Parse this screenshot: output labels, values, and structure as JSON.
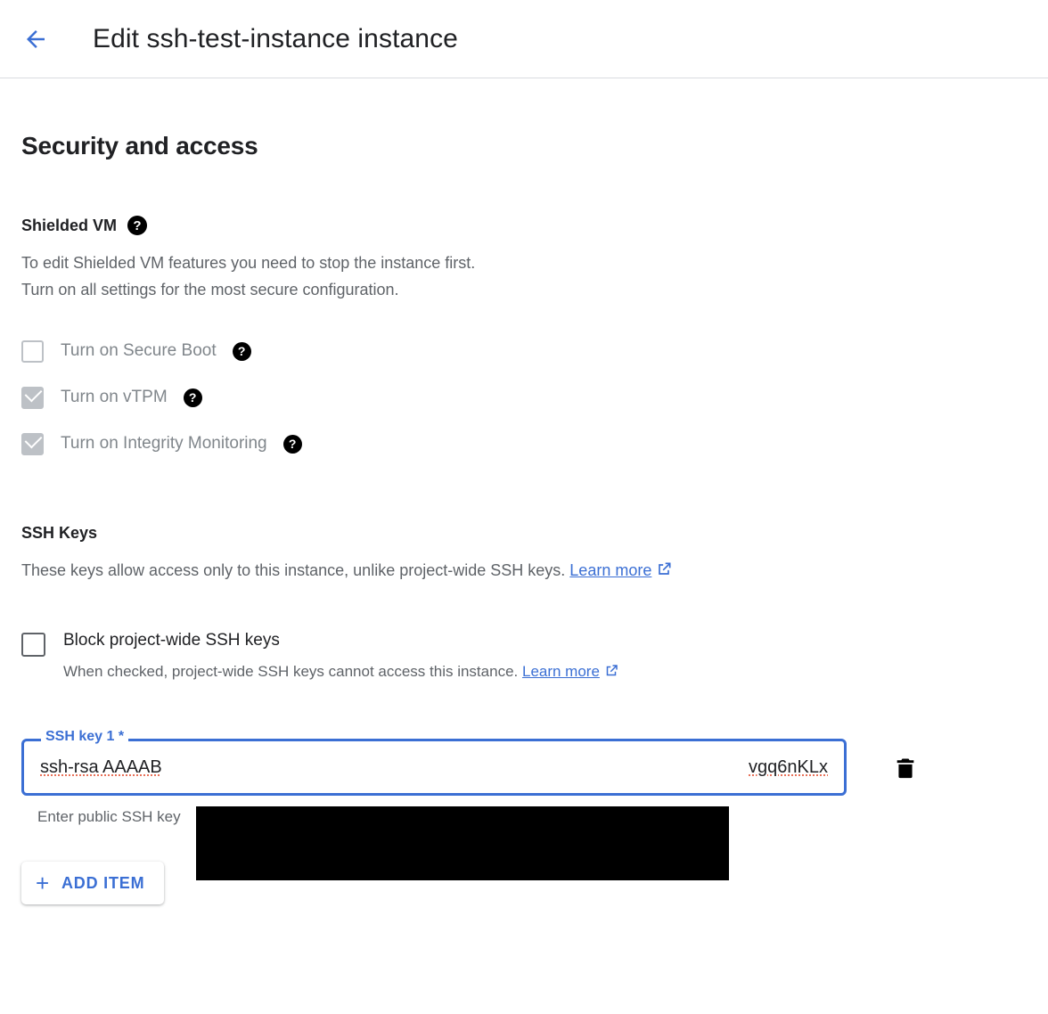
{
  "header": {
    "back_icon": "arrow-left-icon",
    "title": "Edit ssh-test-instance instance"
  },
  "main": {
    "section_title": "Security and access",
    "shielded_vm": {
      "heading": "Shielded VM",
      "help_icon": "help-icon",
      "description_line1": "To edit Shielded VM features you need to stop the instance first.",
      "description_line2": "Turn on all settings for the most secure configuration.",
      "options": [
        {
          "label": "Turn on Secure Boot",
          "checked": false,
          "disabled": true
        },
        {
          "label": "Turn on vTPM",
          "checked": true,
          "disabled": true
        },
        {
          "label": "Turn on Integrity Monitoring",
          "checked": true,
          "disabled": true
        }
      ]
    },
    "ssh_keys": {
      "heading": "SSH Keys",
      "description": "These keys allow access only to this instance, unlike project-wide SSH keys.",
      "learn_more": "Learn more",
      "external_link_icon": "external-link-icon",
      "block_project_wide": {
        "label": "Block project-wide SSH keys",
        "description": "When checked, project-wide SSH keys cannot access this instance.",
        "learn_more": "Learn more",
        "checked": false
      },
      "key_field": {
        "label": "SSH key 1 *",
        "value_start": "ssh-rsa AAAAB",
        "value_end": "vgq6nKLx",
        "hint": "Enter public SSH key",
        "delete_icon": "trash-icon"
      },
      "add_item": {
        "plus": "+",
        "label": "ADD ITEM"
      }
    }
  },
  "colors": {
    "accent_blue": "#3b6fd4",
    "text_primary": "#202124",
    "text_secondary": "#5f6368",
    "disabled_gray": "#bdc1c6",
    "divider": "#dadce0"
  }
}
